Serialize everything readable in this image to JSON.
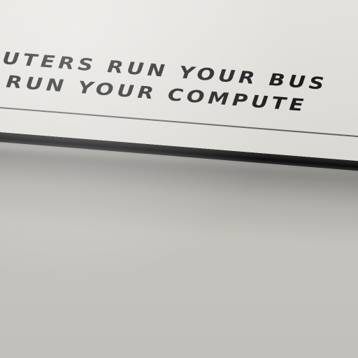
{
  "photo": {
    "subject": "sign-plaque",
    "plaque": {
      "line1": "UTERS RUN YOUR BUS",
      "line2": "RUN YOUR COMPUTE"
    }
  }
}
